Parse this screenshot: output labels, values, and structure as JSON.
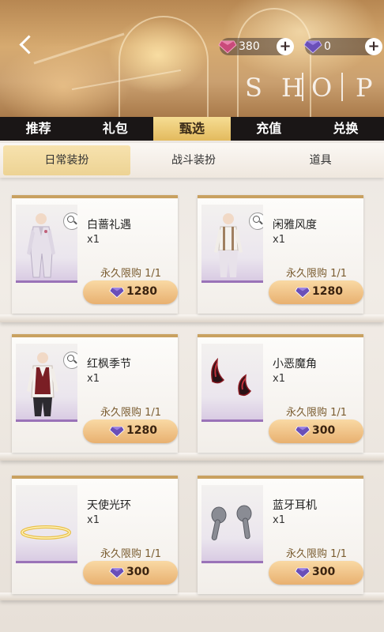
{
  "header": {
    "currency": [
      {
        "amount": "380",
        "gem_color": "#c94a7a"
      },
      {
        "amount": "0",
        "gem_color": "#6a4fb8"
      }
    ],
    "banner_letters": [
      "S",
      "H",
      "O",
      "P"
    ]
  },
  "tabs": [
    {
      "label": "推荐",
      "active": false
    },
    {
      "label": "礼包",
      "active": false
    },
    {
      "label": "甄选",
      "active": true
    },
    {
      "label": "充值",
      "active": false
    },
    {
      "label": "兑换",
      "active": false
    }
  ],
  "subtabs": [
    {
      "label": "日常装扮",
      "active": true
    },
    {
      "label": "战斗装扮",
      "active": false
    },
    {
      "label": "道具",
      "active": false
    }
  ],
  "items": [
    {
      "name": "白蔷礼遇",
      "qty": "x1",
      "limit": "永久限购 1/1",
      "price": "1280",
      "icon": "white-suit-icon",
      "zoom": true
    },
    {
      "name": "闲雅风度",
      "qty": "x1",
      "limit": "永久限购 1/1",
      "price": "1280",
      "icon": "suspenders-outfit-icon",
      "zoom": true
    },
    {
      "name": "红枫季节",
      "qty": "x1",
      "limit": "永久限购 1/1",
      "price": "1280",
      "icon": "red-vest-outfit-icon",
      "zoom": true
    },
    {
      "name": "小恶魔角",
      "qty": "x1",
      "limit": "永久限购 1/1",
      "price": "300",
      "icon": "devil-horns-icon",
      "zoom": false
    },
    {
      "name": "天使光环",
      "qty": "x1",
      "limit": "永久限购 1/1",
      "price": "300",
      "icon": "angel-halo-icon",
      "zoom": false
    },
    {
      "name": "蓝牙耳机",
      "qty": "x1",
      "limit": "永久限购 1/1",
      "price": "300",
      "icon": "bluetooth-earbuds-icon",
      "zoom": false
    }
  ],
  "colors": {
    "accent_gold": "#e3ba5e",
    "tab_bar": "#1a1616",
    "purple_gem": "#6a4fb8"
  }
}
